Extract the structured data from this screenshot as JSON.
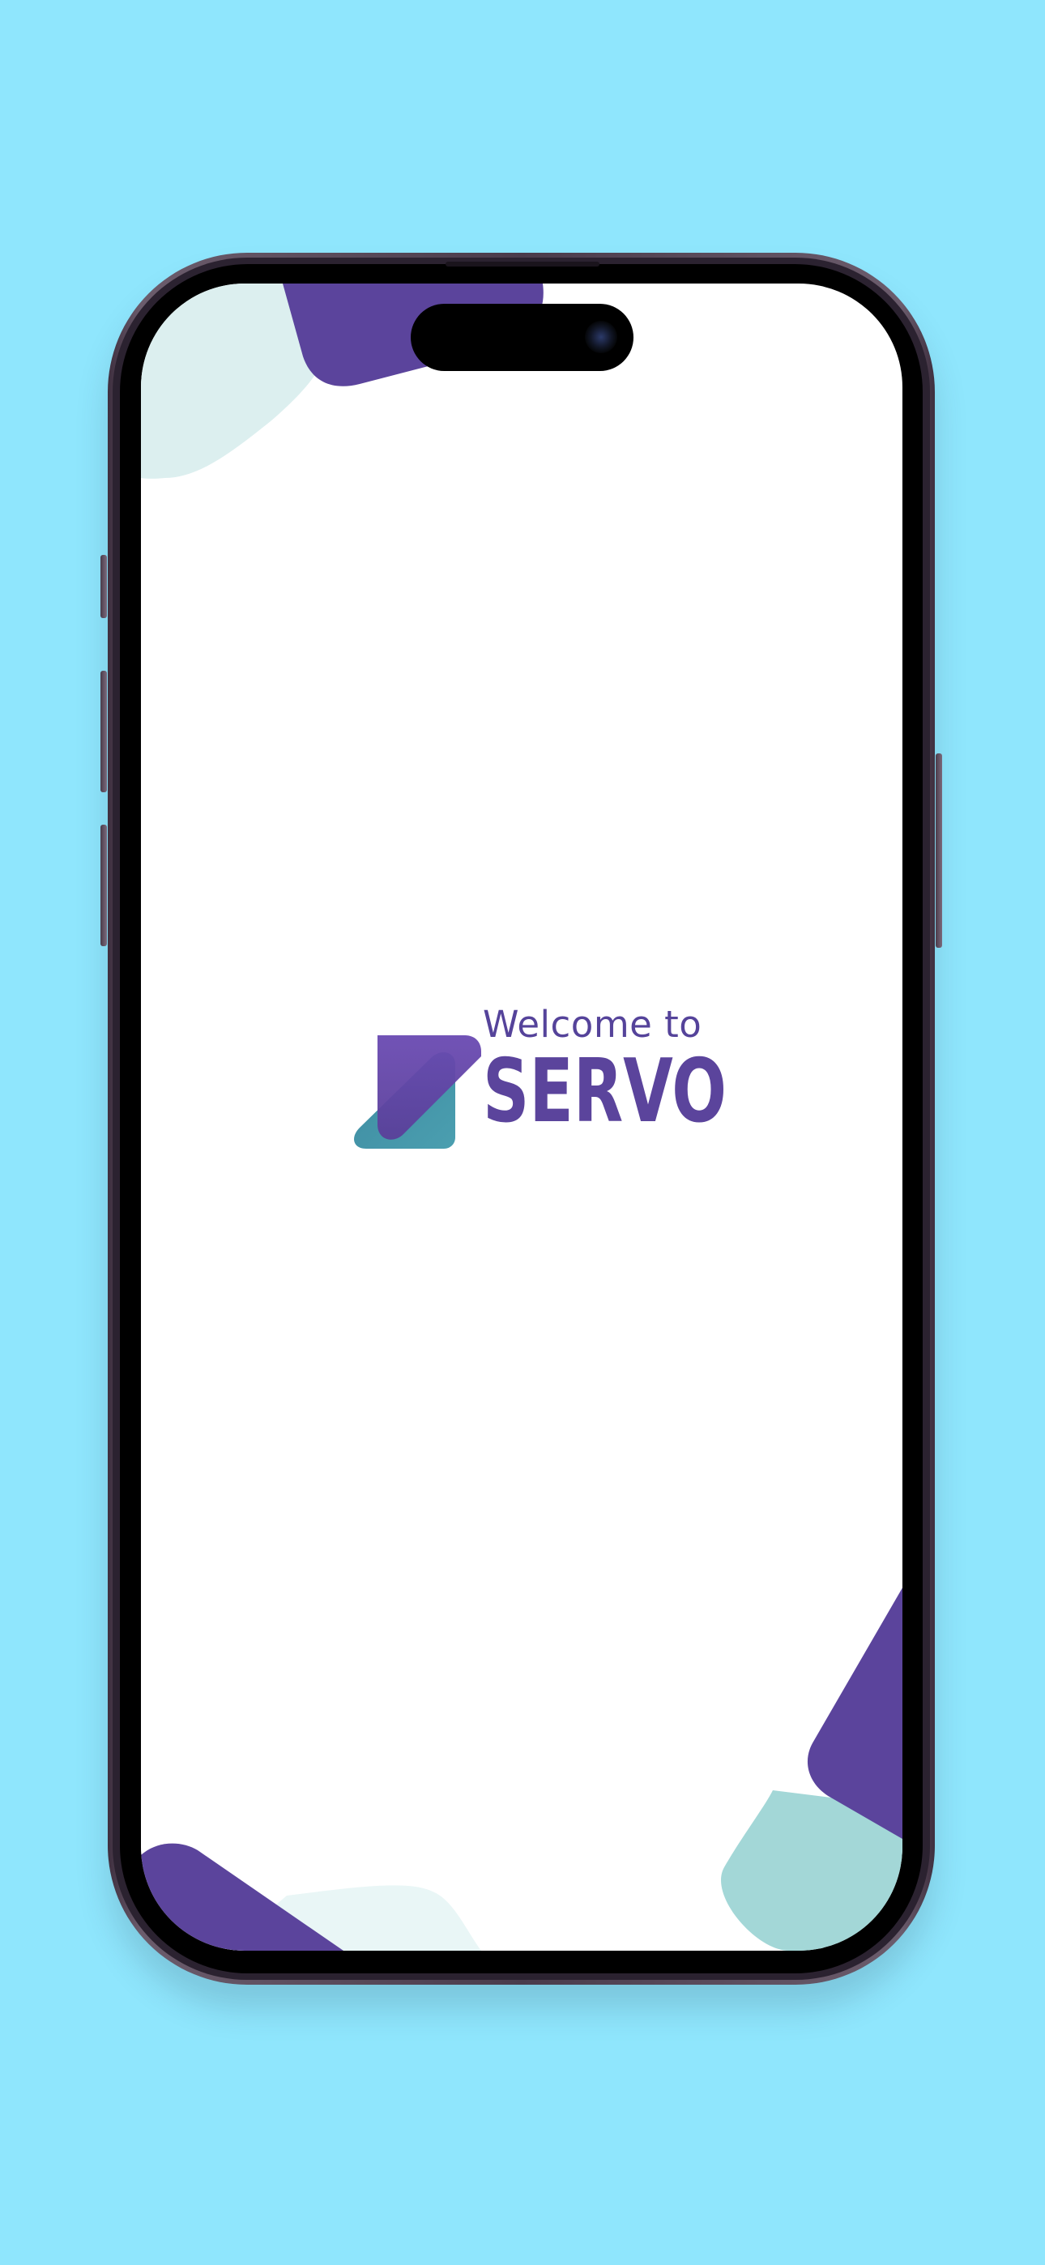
{
  "splash": {
    "welcome": "Welcome to",
    "brand": "SERVO"
  },
  "colors": {
    "background": "#8fe6fd",
    "brand_purple": "#5b449c",
    "brand_teal": "#4a9aac",
    "mint": "#dcefef",
    "mint_dark": "#a3d7d7"
  },
  "icons": {
    "logo": "servo-logo-icon",
    "camera": "front-camera-icon"
  }
}
